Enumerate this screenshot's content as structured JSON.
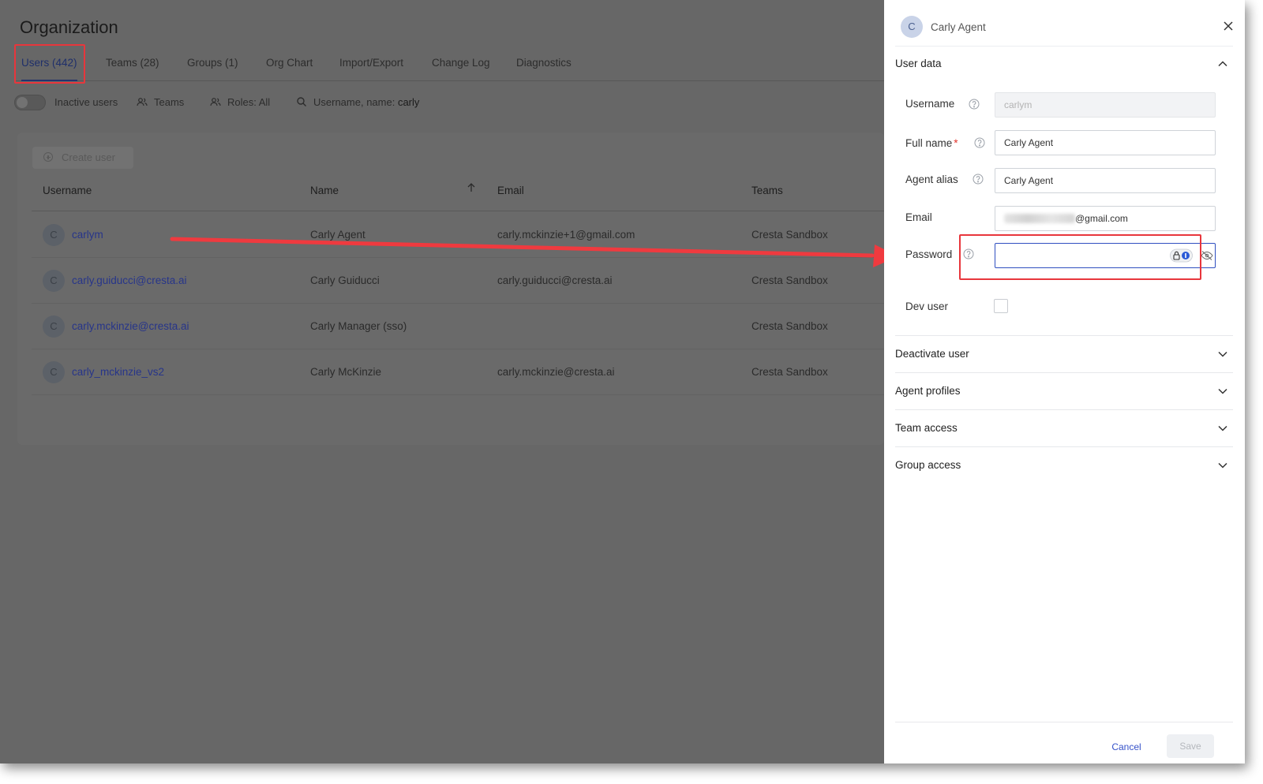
{
  "page": {
    "title": "Organization"
  },
  "tabs": [
    {
      "label": "Users (442)",
      "active": true
    },
    {
      "label": "Teams (28)"
    },
    {
      "label": "Groups (1)"
    },
    {
      "label": "Org Chart"
    },
    {
      "label": "Import/Export"
    },
    {
      "label": "Change Log"
    },
    {
      "label": "Diagnostics"
    }
  ],
  "filters": {
    "inactive_users": "Inactive users",
    "teams": "Teams",
    "roles": "Roles: All",
    "search_prefix": "Username, name:",
    "search_value": "carly"
  },
  "table": {
    "create_button": "Create user",
    "columns": [
      "Username",
      "Name",
      "Email",
      "Teams"
    ],
    "rows": [
      {
        "avatar": "C",
        "username": "carlym",
        "name": "Carly Agent",
        "email": "carly.mckinzie+1@gmail.com",
        "team": "Cresta Sandbox"
      },
      {
        "avatar": "C",
        "username": "carly.guiducci@cresta.ai",
        "name": "Carly Guiducci",
        "email": "carly.guiducci@cresta.ai",
        "team": "Cresta Sandbox"
      },
      {
        "avatar": "C",
        "username": "carly.mckinzie@cresta.ai",
        "name": "Carly Manager (sso)",
        "email": "",
        "team": "Cresta Sandbox"
      },
      {
        "avatar": "C",
        "username": "carly_mckinzie_vs2",
        "name": "Carly McKinzie",
        "email": "carly.mckinzie@cresta.ai",
        "team": "Cresta Sandbox"
      }
    ]
  },
  "drawer": {
    "avatar": "C",
    "user_name": "Carly Agent",
    "section_user_data": "User data",
    "fields": {
      "username_label": "Username",
      "username_value": "carlym",
      "fullname_label": "Full name",
      "required_mark": "*",
      "fullname_value": "Carly Agent",
      "alias_label": "Agent alias",
      "alias_value": "Carly Agent",
      "email_label": "Email",
      "email_domain": "@gmail.com",
      "password_label": "Password",
      "password_value": "",
      "devuser_label": "Dev user"
    },
    "sections": [
      "Deactivate user",
      "Agent profiles",
      "Team access",
      "Group access"
    ],
    "cancel": "Cancel",
    "save": "Save"
  },
  "colors": {
    "highlight": "#e8363c",
    "link": "#27358a",
    "focus": "#2f4fc0"
  }
}
